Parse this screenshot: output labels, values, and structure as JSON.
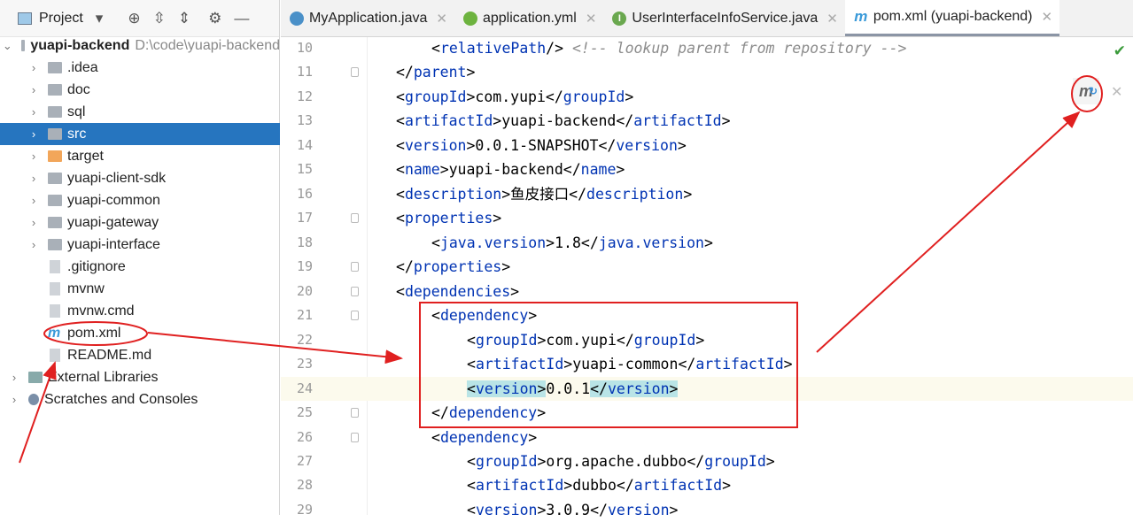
{
  "sidebar": {
    "title": "Project",
    "tree": [
      {
        "label": "yuapi-backend",
        "path": "D:\\code\\yuapi-backend",
        "icon": "module-folder",
        "expanded": true,
        "depth": 0
      },
      {
        "label": ".idea",
        "icon": "folder",
        "depth": 1
      },
      {
        "label": "doc",
        "icon": "folder",
        "depth": 1
      },
      {
        "label": "sql",
        "icon": "folder",
        "depth": 1
      },
      {
        "label": "src",
        "icon": "folder",
        "depth": 1,
        "selected": true
      },
      {
        "label": "target",
        "icon": "folder-orange",
        "depth": 1
      },
      {
        "label": "yuapi-client-sdk",
        "icon": "folder",
        "depth": 1
      },
      {
        "label": "yuapi-common",
        "icon": "folder",
        "depth": 1
      },
      {
        "label": "yuapi-gateway",
        "icon": "folder",
        "depth": 1
      },
      {
        "label": "yuapi-interface",
        "icon": "folder",
        "depth": 1
      },
      {
        "label": ".gitignore",
        "icon": "file",
        "depth": 1,
        "leaf": true
      },
      {
        "label": "mvnw",
        "icon": "file",
        "depth": 1,
        "leaf": true
      },
      {
        "label": "mvnw.cmd",
        "icon": "file",
        "depth": 1,
        "leaf": true
      },
      {
        "label": "pom.xml",
        "icon": "maven",
        "depth": 1,
        "leaf": true
      },
      {
        "label": "README.md",
        "icon": "file",
        "depth": 1,
        "leaf": true
      },
      {
        "label": "External Libraries",
        "icon": "library",
        "depth": 0
      },
      {
        "label": "Scratches and Consoles",
        "icon": "scratch",
        "depth": 0
      }
    ]
  },
  "tabs": [
    {
      "label": "MyApplication.java",
      "icon": "java-class",
      "color": "#4a90c8"
    },
    {
      "label": "application.yml",
      "icon": "spring-yml",
      "color": "#6db33f"
    },
    {
      "label": "UserInterfaceInfoService.java",
      "icon": "interface",
      "color": "#6aa84f"
    },
    {
      "label": "pom.xml (yuapi-backend)",
      "icon": "maven",
      "color": "#3a9ad9",
      "active": true
    }
  ],
  "editor": {
    "maven_icon_label": "m",
    "lines": [
      {
        "n": "10",
        "i": 1,
        "parts": [
          [
            "<",
            "p"
          ],
          [
            "relativePath",
            "t"
          ],
          [
            "/>",
            "p"
          ],
          [
            " <!-- lookup parent from repository -->",
            "c"
          ]
        ]
      },
      {
        "n": "11",
        "i": 0,
        "fold": true,
        "parts": [
          [
            "</",
            "p"
          ],
          [
            "parent",
            "t"
          ],
          [
            ">",
            "p"
          ]
        ]
      },
      {
        "n": "12",
        "i": 0,
        "parts": [
          [
            "<",
            "p"
          ],
          [
            "groupId",
            "t"
          ],
          [
            ">",
            "p"
          ],
          [
            "com.yupi",
            "x"
          ],
          [
            "</",
            "p"
          ],
          [
            "groupId",
            "t"
          ],
          [
            ">",
            "p"
          ]
        ]
      },
      {
        "n": "13",
        "i": 0,
        "parts": [
          [
            "<",
            "p"
          ],
          [
            "artifactId",
            "t"
          ],
          [
            ">",
            "p"
          ],
          [
            "yuapi-backend",
            "x"
          ],
          [
            "</",
            "p"
          ],
          [
            "artifactId",
            "t"
          ],
          [
            ">",
            "p"
          ]
        ]
      },
      {
        "n": "14",
        "i": 0,
        "parts": [
          [
            "<",
            "p"
          ],
          [
            "version",
            "t"
          ],
          [
            ">",
            "p"
          ],
          [
            "0.0.1-SNAPSHOT",
            "x"
          ],
          [
            "</",
            "p"
          ],
          [
            "version",
            "t"
          ],
          [
            ">",
            "p"
          ]
        ]
      },
      {
        "n": "15",
        "i": 0,
        "parts": [
          [
            "<",
            "p"
          ],
          [
            "name",
            "t"
          ],
          [
            ">",
            "p"
          ],
          [
            "yuapi-backend",
            "x"
          ],
          [
            "</",
            "p"
          ],
          [
            "name",
            "t"
          ],
          [
            ">",
            "p"
          ]
        ]
      },
      {
        "n": "16",
        "i": 0,
        "parts": [
          [
            "<",
            "p"
          ],
          [
            "description",
            "t"
          ],
          [
            ">",
            "p"
          ],
          [
            "鱼皮接口",
            "x"
          ],
          [
            "</",
            "p"
          ],
          [
            "description",
            "t"
          ],
          [
            ">",
            "p"
          ]
        ]
      },
      {
        "n": "17",
        "i": 0,
        "fold": true,
        "parts": [
          [
            "<",
            "p"
          ],
          [
            "properties",
            "t"
          ],
          [
            ">",
            "p"
          ]
        ]
      },
      {
        "n": "18",
        "i": 1,
        "parts": [
          [
            "<",
            "p"
          ],
          [
            "java.version",
            "t"
          ],
          [
            ">",
            "p"
          ],
          [
            "1.8",
            "x"
          ],
          [
            "</",
            "p"
          ],
          [
            "java.version",
            "t"
          ],
          [
            ">",
            "p"
          ]
        ]
      },
      {
        "n": "19",
        "i": 0,
        "fold": true,
        "parts": [
          [
            "</",
            "p"
          ],
          [
            "properties",
            "t"
          ],
          [
            ">",
            "p"
          ]
        ]
      },
      {
        "n": "20",
        "i": 0,
        "fold": true,
        "parts": [
          [
            "<",
            "p"
          ],
          [
            "dependencies",
            "t"
          ],
          [
            ">",
            "p"
          ]
        ]
      },
      {
        "n": "21",
        "i": 1,
        "fold": true,
        "parts": [
          [
            "<",
            "p"
          ],
          [
            "dependency",
            "t"
          ],
          [
            ">",
            "p"
          ]
        ]
      },
      {
        "n": "22",
        "i": 2,
        "parts": [
          [
            "<",
            "p"
          ],
          [
            "groupId",
            "t"
          ],
          [
            ">",
            "p"
          ],
          [
            "com.yupi",
            "x"
          ],
          [
            "</",
            "p"
          ],
          [
            "groupId",
            "t"
          ],
          [
            ">",
            "p"
          ]
        ]
      },
      {
        "n": "23",
        "i": 2,
        "parts": [
          [
            "<",
            "p"
          ],
          [
            "artifactId",
            "t"
          ],
          [
            ">",
            "p"
          ],
          [
            "yuapi-common",
            "x"
          ],
          [
            "</",
            "p"
          ],
          [
            "artifactId",
            "t"
          ],
          [
            ">",
            "p"
          ]
        ]
      },
      {
        "n": "24",
        "i": 2,
        "current": true,
        "parts": [
          [
            "<",
            "p hl"
          ],
          [
            "version",
            "t hl"
          ],
          [
            ">",
            "p hl"
          ],
          [
            "0.0.1",
            "x"
          ],
          [
            "</",
            "p hl"
          ],
          [
            "version",
            "t hl"
          ],
          [
            ">",
            "p hl"
          ]
        ]
      },
      {
        "n": "25",
        "i": 1,
        "fold": true,
        "parts": [
          [
            "</",
            "p"
          ],
          [
            "dependency",
            "t"
          ],
          [
            ">",
            "p"
          ]
        ]
      },
      {
        "n": "26",
        "i": 1,
        "fold": true,
        "parts": [
          [
            "<",
            "p"
          ],
          [
            "dependency",
            "t"
          ],
          [
            ">",
            "p"
          ]
        ]
      },
      {
        "n": "27",
        "i": 2,
        "parts": [
          [
            "<",
            "p"
          ],
          [
            "groupId",
            "t"
          ],
          [
            ">",
            "p"
          ],
          [
            "org.apache.dubbo",
            "x"
          ],
          [
            "</",
            "p"
          ],
          [
            "groupId",
            "t"
          ],
          [
            ">",
            "p"
          ]
        ]
      },
      {
        "n": "28",
        "i": 2,
        "parts": [
          [
            "<",
            "p"
          ],
          [
            "artifactId",
            "t"
          ],
          [
            ">",
            "p"
          ],
          [
            "dubbo",
            "x"
          ],
          [
            "</",
            "p"
          ],
          [
            "artifactId",
            "t"
          ],
          [
            ">",
            "p"
          ]
        ]
      },
      {
        "n": "29",
        "i": 2,
        "parts": [
          [
            "<",
            "p"
          ],
          [
            "version",
            "t"
          ],
          [
            ">",
            "p"
          ],
          [
            "3.0.9",
            "x"
          ],
          [
            "</",
            "p"
          ],
          [
            "version",
            "t"
          ],
          [
            ">",
            "p"
          ]
        ]
      }
    ]
  },
  "annotation_color": "#e02020"
}
